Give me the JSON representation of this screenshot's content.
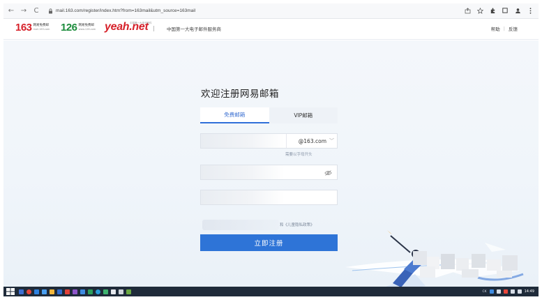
{
  "browser": {
    "url": "mail.163.com/register/index.htm?from=163mail&utm_source=163mail",
    "nav": {
      "back": "←",
      "forward": "→",
      "reload": "C"
    }
  },
  "header": {
    "logo_163": {
      "number": "163",
      "sub1": "网易免费邮",
      "sub2": "mail.163.com"
    },
    "logo_126": {
      "number": "126",
      "sub1": "网易免费邮",
      "sub2": "www.126.com"
    },
    "logo_yeah": {
      "text": "yeah.net",
      "tag": "中国第一大电子邮件"
    },
    "slogan": "中国第一大电子邮件服务商",
    "links": {
      "help": "帮助",
      "feedback": "反馈",
      "separator": "|"
    }
  },
  "register": {
    "title": "欢迎注册网易邮箱",
    "tabs": [
      {
        "label": "免费邮箱",
        "active": true
      },
      {
        "label": "VIP邮箱",
        "active": false
      }
    ],
    "email_domain": "@163.com",
    "email_hint": "需要以字母开头",
    "privacy_text": "和《儿童隐私政策》",
    "submit_label": "立即注册"
  },
  "taskbar": {
    "ime": "CK",
    "clock": "14:49"
  },
  "colors": {
    "accent": "#2e74d7",
    "brand_163_red": "#d6212a",
    "brand_126_green": "#1c8c3c",
    "taskbar": "#1f2b3a"
  }
}
